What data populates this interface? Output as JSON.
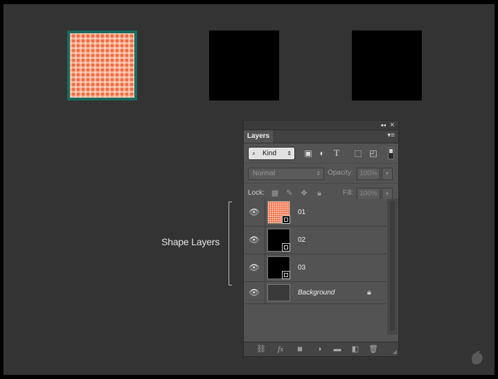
{
  "canvas": {
    "shape_colors": {
      "pattern": "#f26a44",
      "stroke": "#1a6b5f",
      "black": "#000000"
    }
  },
  "annotation": {
    "label": "Shape Layers"
  },
  "panel": {
    "collapse_icon": "◂◂",
    "close_icon": "✕",
    "tab_label": "Layers",
    "menu_icon": "▾≡",
    "filter": {
      "kind_label": "Kind",
      "icons": [
        "image-filter-icon",
        "adjustment-filter-icon",
        "type-filter-icon",
        "shape-filter-icon",
        "smart-object-filter-icon"
      ]
    },
    "blend": {
      "mode": "Normal",
      "opacity_label": "Opacity:",
      "opacity_value": "100%"
    },
    "lock": {
      "label": "Lock:",
      "fill_label": "Fill:",
      "fill_value": "100%"
    },
    "layers": [
      {
        "name": "01",
        "type": "shape",
        "visible": true
      },
      {
        "name": "02",
        "type": "shape",
        "visible": true
      },
      {
        "name": "03",
        "type": "shape",
        "visible": true
      },
      {
        "name": "Background",
        "type": "background",
        "visible": true,
        "locked": true
      }
    ],
    "bottom_icons": [
      "link-layers-icon",
      "fx-icon",
      "add-mask-icon",
      "adjustment-layer-icon",
      "new-group-icon",
      "new-layer-icon",
      "delete-layer-icon"
    ],
    "fx_label": "fx"
  }
}
